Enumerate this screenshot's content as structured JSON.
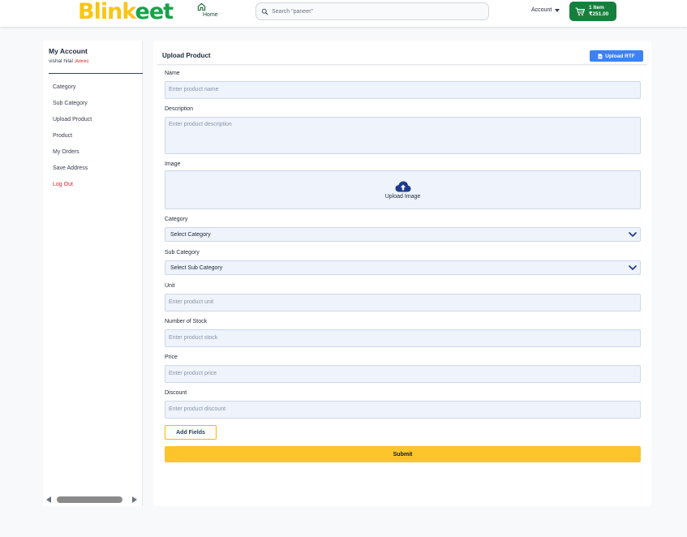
{
  "header": {
    "logo_part1": "Blink",
    "logo_part2": "eet",
    "home_label": "Home",
    "search_placeholder": "Search \"paneer\"",
    "account_label": "Account",
    "cart_items": "1 Item",
    "cart_total": "₹251.00"
  },
  "sidebar": {
    "title": "My Account",
    "user_name": "vishal hilal",
    "user_role": "(Admin)",
    "items": [
      {
        "label": "Category"
      },
      {
        "label": "Sub Category"
      },
      {
        "label": "Upload Product"
      },
      {
        "label": "Product"
      },
      {
        "label": "My Orders"
      },
      {
        "label": "Save Address"
      },
      {
        "label": "Log Out"
      }
    ]
  },
  "main": {
    "title": "Upload Product",
    "upload_rtf_label": "Upload RTF",
    "fields": {
      "name": {
        "label": "Name",
        "placeholder": "Enter product name"
      },
      "description": {
        "label": "Description",
        "placeholder": "Enter product description"
      },
      "image": {
        "label": "Image",
        "upload_text": "Upload Image"
      },
      "category": {
        "label": "Category",
        "selected": "Select Category"
      },
      "sub_category": {
        "label": "Sub Category",
        "selected": "Select Sub Category"
      },
      "unit": {
        "label": "Unit",
        "placeholder": "Enter product unit"
      },
      "stock": {
        "label": "Number of Stock",
        "placeholder": "Enter product stock"
      },
      "price": {
        "label": "Price",
        "placeholder": "Enter product price"
      },
      "discount": {
        "label": "Discount",
        "placeholder": "Enter product discount"
      }
    },
    "add_fields_label": "Add Fields",
    "submit_label": "Submit"
  },
  "colors": {
    "brand_yellow": "#f8c514",
    "brand_green": "#16a34a",
    "cart_green": "#15803d",
    "rtf_blue": "#3b82f6",
    "submit_yellow": "#fdc52c",
    "logout_red": "#dc2626"
  }
}
